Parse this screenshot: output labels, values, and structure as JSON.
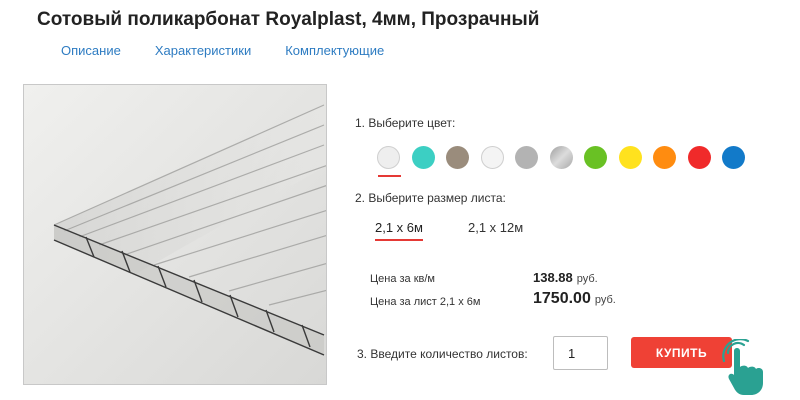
{
  "product": {
    "title": "Сотовый поликарбонат Royalplast, 4мм, Прозрачный"
  },
  "tabs": [
    "Описание",
    "Характеристики",
    "Комплектующие"
  ],
  "color_step": {
    "label": "1. Выберите цвет:",
    "selected_index": 0,
    "swatches": [
      {
        "name": "white-transparent",
        "color": "#eeeeee"
      },
      {
        "name": "turquoise",
        "color": "#3ccfc3"
      },
      {
        "name": "bronze",
        "color": "#9a8c7c"
      },
      {
        "name": "opal-white",
        "color": "#f4f4f4"
      },
      {
        "name": "gray",
        "color": "#b3b3b3"
      },
      {
        "name": "silver",
        "color": "#c2c2c2"
      },
      {
        "name": "green",
        "color": "#69c124"
      },
      {
        "name": "yellow",
        "color": "#ffe21e"
      },
      {
        "name": "orange",
        "color": "#ff8c10"
      },
      {
        "name": "red",
        "color": "#f02a2a"
      },
      {
        "name": "blue",
        "color": "#127ac9"
      }
    ]
  },
  "size_step": {
    "label": "2. Выберите размер листа:",
    "options": [
      "2,1 х 6м",
      "2,1 х 12м"
    ],
    "selected_index": 0
  },
  "prices": {
    "per_sqm_label": "Цена за кв/м",
    "per_sqm_value": "138.88",
    "per_sheet_label": "Цена за лист 2,1 х 6м",
    "per_sheet_value": "1750.00",
    "currency": "руб."
  },
  "quantity_step": {
    "label": "3. Введите количество листов:",
    "value": "1"
  },
  "buy_button": {
    "label": "КУПИТЬ"
  },
  "colors": {
    "accent_red": "#ef4135",
    "link_blue": "#2e7cc2",
    "hand_teal": "#2aa192"
  }
}
